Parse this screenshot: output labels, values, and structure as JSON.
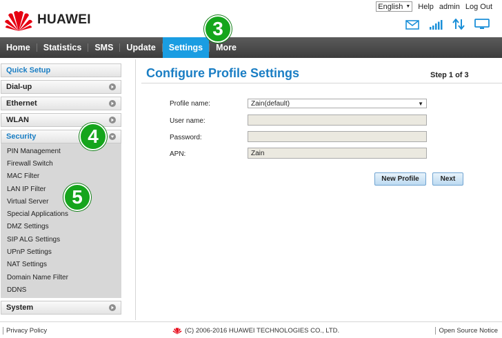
{
  "brand": {
    "name": "HUAWEI",
    "logo_icon": "huawei-petal-logo",
    "logo_color": "#e60012"
  },
  "top_links": {
    "language": "English",
    "help": "Help",
    "user": "admin",
    "logout": "Log Out"
  },
  "status_icons": [
    "mail-icon",
    "signal-strength-icon",
    "data-transfer-icon",
    "device-connected-icon"
  ],
  "nav": {
    "items": [
      {
        "label": "Home",
        "active": false
      },
      {
        "label": "Statistics",
        "active": false
      },
      {
        "label": "SMS",
        "active": false
      },
      {
        "label": "Update",
        "active": false
      },
      {
        "label": "Settings",
        "active": true
      },
      {
        "label": "More",
        "active": false
      }
    ],
    "active_color": "#1a9de2"
  },
  "sidebar": {
    "quick_setup": "Quick Setup",
    "dialup": "Dial-up",
    "ethernet": "Ethernet",
    "wlan": "WLAN",
    "security": "Security",
    "security_items": [
      "PIN Management",
      "Firewall Switch",
      "MAC Filter",
      "LAN IP Filter",
      "Virtual Server",
      "Special Applications",
      "DMZ Settings",
      "SIP ALG Settings",
      "UPnP Settings",
      "NAT Settings",
      "Domain Name Filter",
      "DDNS"
    ],
    "system": "System"
  },
  "main": {
    "title": "Configure Profile Settings",
    "step": "Step 1 of 3",
    "form": {
      "profile_name_label": "Profile name:",
      "profile_name_value": "Zain(default)",
      "user_name_label": "User name:",
      "user_name_value": "",
      "password_label": "Password:",
      "password_value": "",
      "apn_label": "APN:",
      "apn_value": "Zain"
    },
    "buttons": {
      "new_profile": "New Profile",
      "next": "Next"
    }
  },
  "badges": {
    "b3": "3",
    "b4": "4",
    "b5": "5",
    "color": "#15a51c"
  },
  "footer": {
    "privacy": "Privacy Policy",
    "copyright": "(C) 2006-2016 HUAWEI TECHNOLOGIES CO., LTD.",
    "open_source": "Open Source Notice"
  }
}
